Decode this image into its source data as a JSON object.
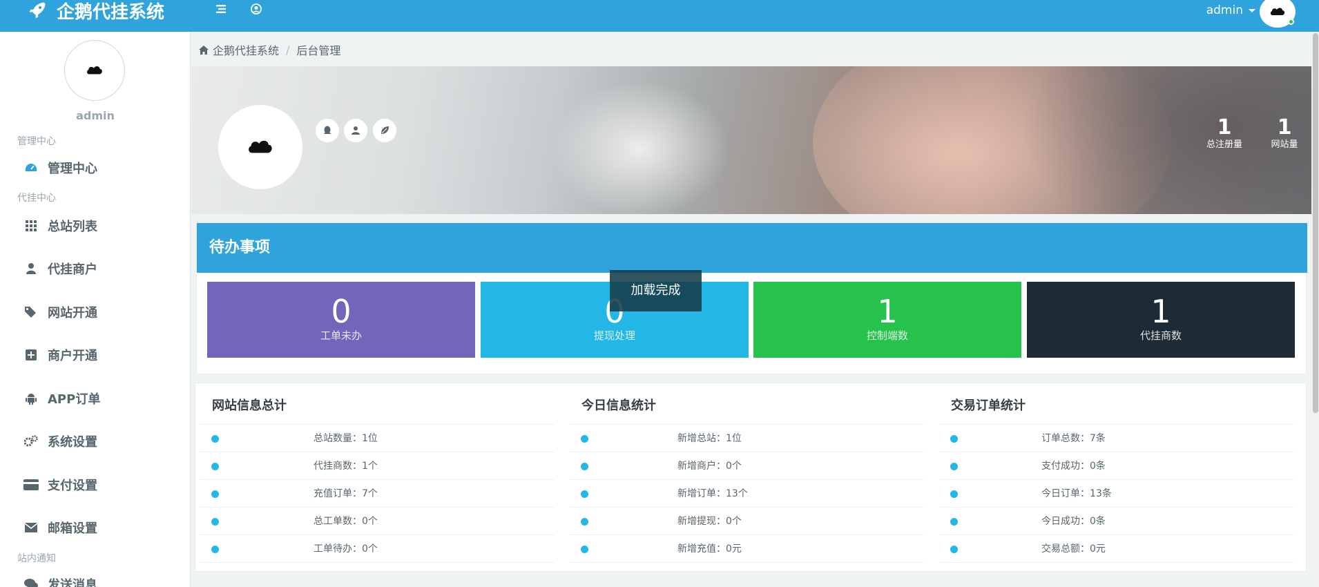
{
  "header": {
    "brand": "企鹅代挂系统",
    "user": "admin"
  },
  "sidebar": {
    "username": "admin",
    "groups": {
      "admin": "管理中心",
      "proxy": "代挂中心",
      "notice": "站内通知"
    },
    "items": [
      {
        "label": "管理中心",
        "icon": "dashboard-icon"
      },
      {
        "label": "总站列表",
        "icon": "grid-icon"
      },
      {
        "label": "代挂商户",
        "icon": "user-icon"
      },
      {
        "label": "网站开通",
        "icon": "tags-icon"
      },
      {
        "label": "商户开通",
        "icon": "plus-square-icon"
      },
      {
        "label": "APP订单",
        "icon": "android-icon"
      },
      {
        "label": "系统设置",
        "icon": "cogs-icon"
      },
      {
        "label": "支付设置",
        "icon": "credit-card-icon"
      },
      {
        "label": "邮箱设置",
        "icon": "envelope-icon"
      },
      {
        "label": "发送消息",
        "icon": "comments-icon"
      }
    ]
  },
  "breadcrumb": {
    "home": "企鹅代挂系统",
    "current": "后台管理"
  },
  "banner": {
    "stats": [
      {
        "value": "1",
        "label": "总注册量"
      },
      {
        "value": "1",
        "label": "网站量"
      }
    ]
  },
  "todo": {
    "title": "待办事项",
    "tiles": [
      {
        "value": "0",
        "label": "工单未办",
        "color": "#7266ba"
      },
      {
        "value": "0",
        "label": "提现处理",
        "color": "#23b7e5"
      },
      {
        "value": "1",
        "label": "控制端数",
        "color": "#27c24c"
      },
      {
        "value": "1",
        "label": "代挂商数",
        "color": "#1c2b36"
      }
    ]
  },
  "toast": "加载完成",
  "info": [
    {
      "title": "网站信息总计",
      "rows": [
        "总站数量：1位",
        "代挂商数：1个",
        "充值订单：7个",
        "总工单数：0个",
        "工单待办：0个"
      ]
    },
    {
      "title": "今日信息统计",
      "rows": [
        "新增总站：1位",
        "新增商户：0个",
        "新增订单：13个",
        "新增提现：0个",
        "新增充值：0元"
      ]
    },
    {
      "title": "交易订单统计",
      "rows": [
        "订单总数：7条",
        "支付成功：0条",
        "今日订单：13条",
        "今日成功：0条",
        "交易总额：0元"
      ]
    }
  ]
}
